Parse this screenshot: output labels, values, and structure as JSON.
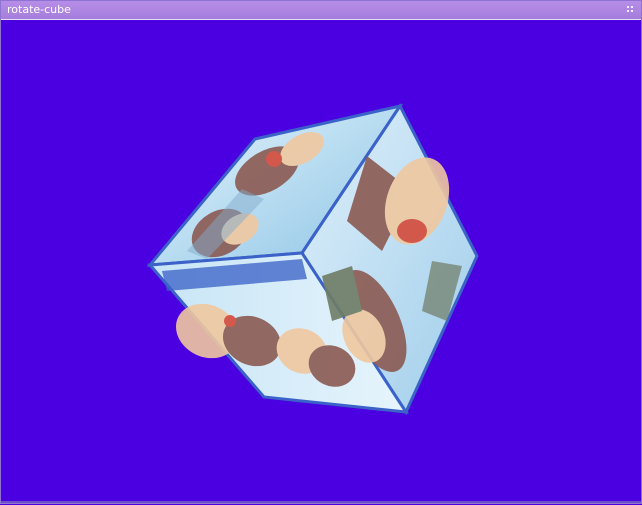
{
  "window": {
    "title": "rotate-cube"
  },
  "icons": {
    "title_grip": "grip-icon"
  },
  "colors": {
    "background": "#4a00e0",
    "titlebar": "#a57ddc",
    "cube_face_light": "#cfe8f7",
    "cube_edge_blue": "#3b62c8",
    "figure_skin": "#f0c8a0",
    "figure_hair": "#8b5a52"
  }
}
